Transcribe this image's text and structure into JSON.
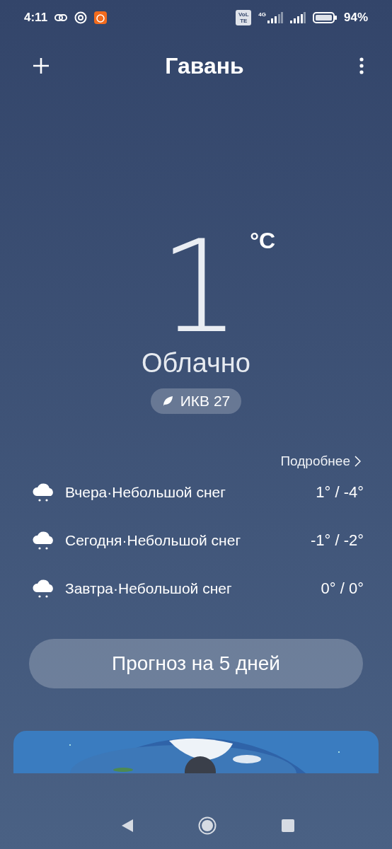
{
  "status_bar": {
    "time": "4:11",
    "volte": "VoLTE",
    "network": "4G",
    "battery": "94%"
  },
  "header": {
    "title": "Гавань"
  },
  "current": {
    "temperature": "1",
    "unit": "°C",
    "condition": "Облачно",
    "aqi": "ИКВ 27"
  },
  "details_link": "Подробнее",
  "forecast": [
    {
      "label": "Вчера·Небольшой снег",
      "temps": "1° / -4°"
    },
    {
      "label": "Сегодня·Небольшой снег",
      "temps": "-1° / -2°"
    },
    {
      "label": "Завтра·Небольшой снег",
      "temps": "0° / 0°"
    }
  ],
  "forecast_button": "Прогноз на 5 дней"
}
